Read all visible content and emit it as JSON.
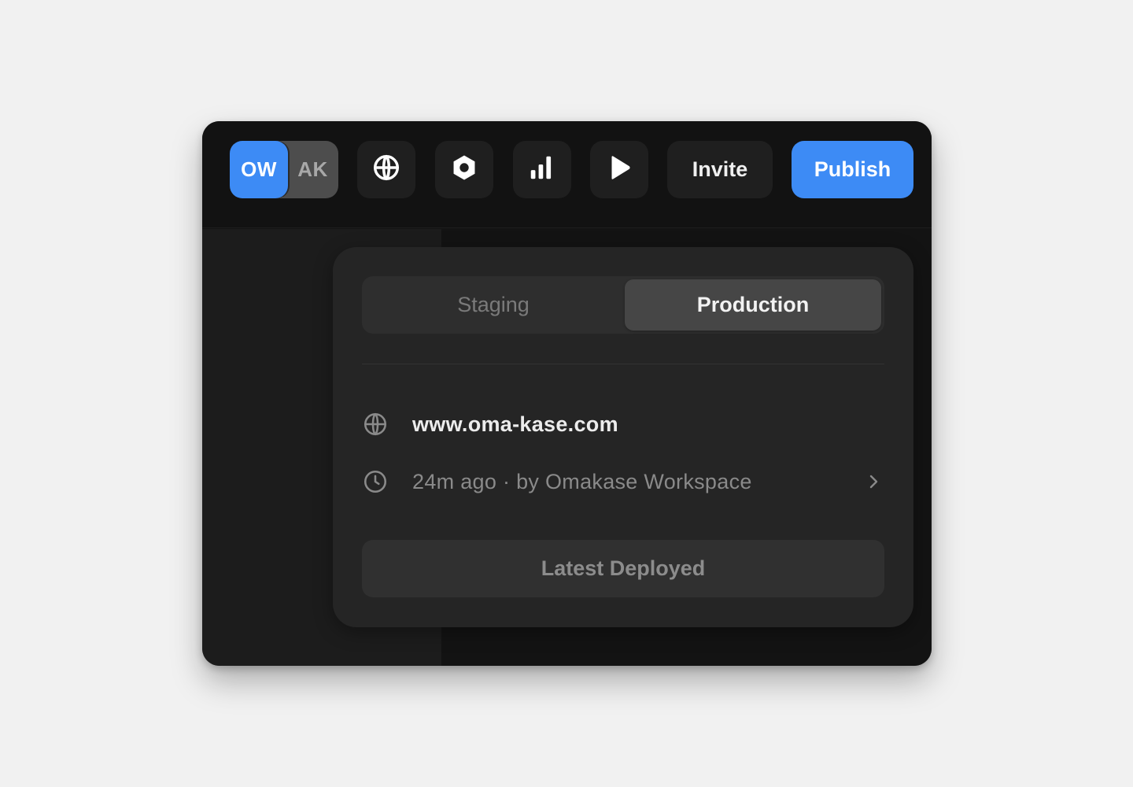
{
  "toolbar": {
    "avatars": [
      {
        "initials": "OW",
        "color": "#3d8bf5"
      },
      {
        "initials": "AK",
        "color": "#4d4d4d"
      }
    ],
    "icons": [
      "globe-icon",
      "settings-hexagon-icon",
      "analytics-bars-icon",
      "play-icon"
    ],
    "invite_label": "Invite",
    "publish_label": "Publish"
  },
  "popover": {
    "tabs": [
      {
        "label": "Staging",
        "active": false
      },
      {
        "label": "Production",
        "active": true
      }
    ],
    "domain": "www.oma-kase.com",
    "deploy_info": "24m ago · by Omakase Workspace",
    "latest_button_label": "Latest Deployed"
  },
  "colors": {
    "accent": "#3d8bf5",
    "window_bg": "#131313",
    "popover_bg": "#252525"
  }
}
